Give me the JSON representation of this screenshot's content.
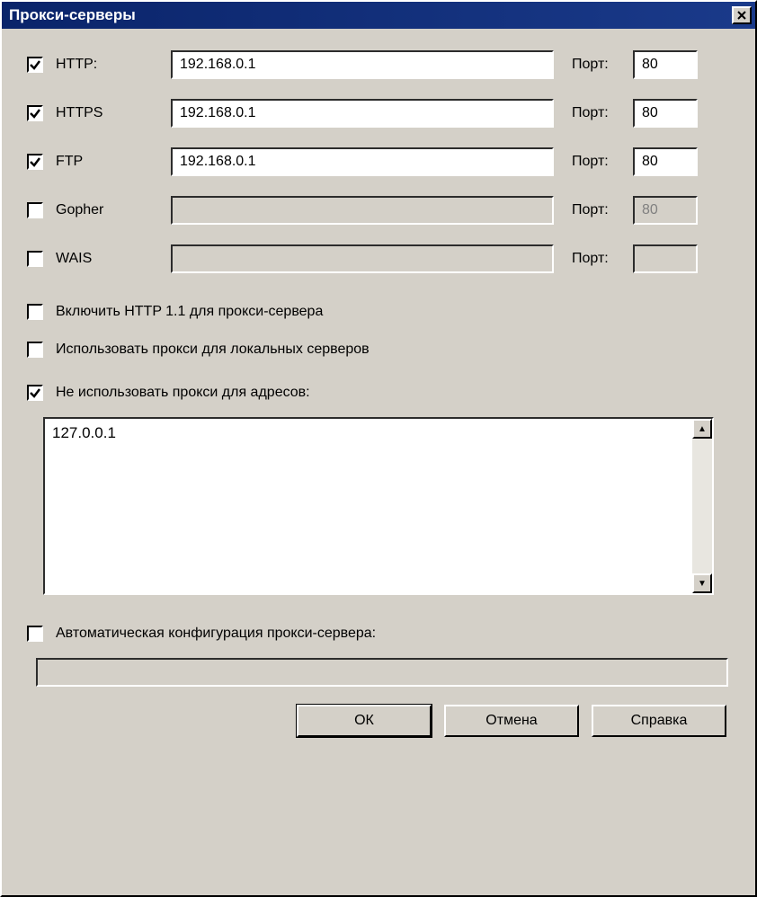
{
  "window": {
    "title": "Прокси-серверы"
  },
  "proxies": [
    {
      "enabled": true,
      "label": "HTTP:",
      "host": "192.168.0.1",
      "portLabel": "Порт:",
      "port": "80"
    },
    {
      "enabled": true,
      "label": "HTTPS",
      "host": "192.168.0.1",
      "portLabel": "Порт:",
      "port": "80"
    },
    {
      "enabled": true,
      "label": "FTP",
      "host": "192.168.0.1",
      "portLabel": "Порт:",
      "port": "80"
    },
    {
      "enabled": false,
      "label": "Gopher",
      "host": "",
      "portLabel": "Порт:",
      "port": "80"
    },
    {
      "enabled": false,
      "label": "WAIS",
      "host": "",
      "portLabel": "Порт:",
      "port": ""
    }
  ],
  "options": {
    "http11": {
      "checked": false,
      "label": "Включить HTTP 1.1 для прокси-сервера"
    },
    "useLocal": {
      "checked": false,
      "label": "Использовать прокси для локальных серверов"
    },
    "noProxy": {
      "checked": true,
      "label": "Не использовать прокси для адресов:"
    }
  },
  "noProxyList": "127.0.0.1",
  "autoConfig": {
    "checked": false,
    "label": "Автоматическая конфигурация прокси-сервера:",
    "url": ""
  },
  "buttons": {
    "ok": "ОК",
    "cancel": "Отмена",
    "help": "Справка"
  }
}
